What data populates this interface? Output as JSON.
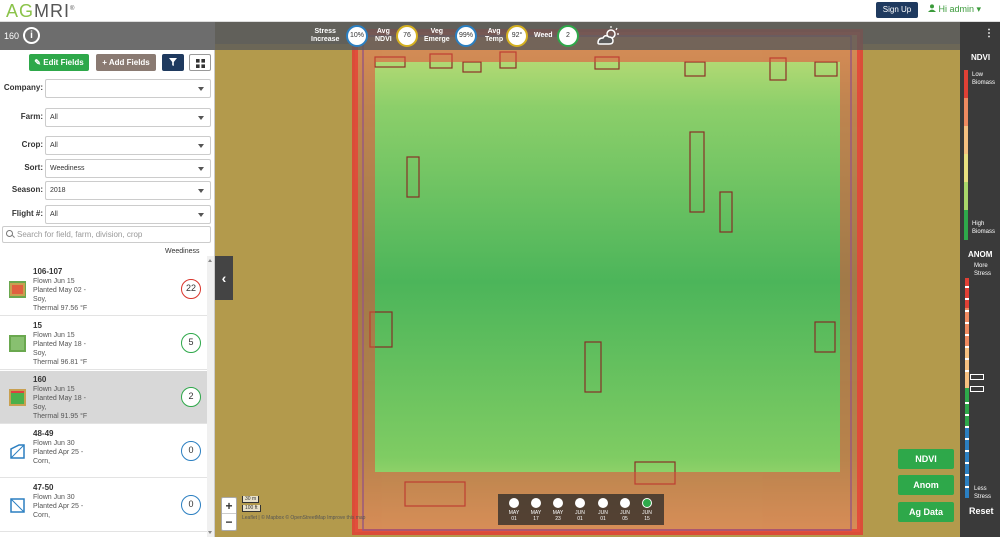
{
  "header": {
    "logo_ag": "AG",
    "logo_mri": "MRI",
    "logo_mark": "®",
    "signup": "Sign Up",
    "user": "Hi admin"
  },
  "fieldbar": {
    "field_number": "160",
    "info_icon": "info-icon"
  },
  "toolbar": {
    "edit_fields": "Edit Fields",
    "add_fields": "Add Fields",
    "filter_icon": "filter-icon",
    "grid_icon": "grid-icon"
  },
  "filters": [
    {
      "label": "Company:",
      "value": ""
    },
    {
      "label": "Farm:",
      "value": "All"
    },
    {
      "label": "Crop:",
      "value": "All"
    },
    {
      "label": "Sort:",
      "value": "Weediness"
    },
    {
      "label": "Season:",
      "value": "2018"
    },
    {
      "label": "Flight #:",
      "value": "All"
    }
  ],
  "search": {
    "placeholder": "Search for field, farm, division, crop"
  },
  "list_header": "Weediness",
  "fields": [
    {
      "name": "106-107",
      "flown": "Flown Jun 15",
      "planted": "Planted May 02 -",
      "crop": "Soy,",
      "thermal": "Thermal 97.56 °F",
      "weed": "22",
      "color": "#d9342b",
      "selected": false
    },
    {
      "name": "15",
      "flown": "Flown Jun 15",
      "planted": "Planted May 18 -",
      "crop": "Soy,",
      "thermal": "Thermal 96.81 °F",
      "weed": "5",
      "color": "#2ea84a",
      "selected": false
    },
    {
      "name": "160",
      "flown": "Flown Jun 15",
      "planted": "Planted May 18 -",
      "crop": "Soy,",
      "thermal": "Thermal 91.95 °F",
      "weed": "2",
      "color": "#2ea84a",
      "selected": true
    },
    {
      "name": "48-49",
      "flown": "Flown Jun 30",
      "planted": "Planted Apr 25 -",
      "crop": "Corn,",
      "thermal": "",
      "weed": "0",
      "color": "#2b7fc1",
      "selected": false
    },
    {
      "name": "47-50",
      "flown": "Flown Jun 30",
      "planted": "Planted Apr 25 -",
      "crop": "Corn,",
      "thermal": "",
      "weed": "0",
      "color": "#2b7fc1",
      "selected": false
    }
  ],
  "stats": {
    "stress_l1": "Stress",
    "stress_l2": "Increase",
    "stress_v": "10%",
    "ndvi_l1": "Avg",
    "ndvi_l2": "NDVI",
    "ndvi_v": "76",
    "emerge_l1": "Veg",
    "emerge_l2": "Emerge",
    "emerge_v": "99%",
    "temp_l1": "Avg",
    "temp_l2": "Temp",
    "temp_v": "92°",
    "weed_l1": "Weed",
    "weed_v": "2",
    "weather_icon": "partly-cloudy-icon"
  },
  "map": {
    "collapse_icon": "chevron-left-icon",
    "zoom_in": "+",
    "zoom_out": "−",
    "scale_m": "30 m",
    "scale_ft": "100 ft",
    "attribution": "Leaflet | © Mapbox © OpenStreetMap Improve this map"
  },
  "timeline": [
    {
      "m": "MAY",
      "d": "01",
      "active": false
    },
    {
      "m": "MAY",
      "d": "17",
      "active": false
    },
    {
      "m": "MAY",
      "d": "23",
      "active": false
    },
    {
      "m": "JUN",
      "d": "01",
      "active": false
    },
    {
      "m": "JUN",
      "d": "01",
      "active": false
    },
    {
      "m": "JUN",
      "d": "05",
      "active": false
    },
    {
      "m": "JUN",
      "d": "15",
      "active": true
    }
  ],
  "buttons": {
    "ndvi": "NDVI",
    "anom": "Anom",
    "agdata": "Ag Data"
  },
  "legend": {
    "menu": "⋮",
    "ndvi_title": "NDVI",
    "low_1": "Low",
    "low_2": "Biomass",
    "high_1": "High",
    "high_2": "Biomass",
    "anom_title": "ANOM",
    "more_1": "More",
    "more_2": "Stress",
    "less_1": "Less",
    "less_2": "Stress",
    "reset": "Reset"
  },
  "colors": {
    "brand_green": "#2ea84a",
    "navy": "#1f3a5f",
    "stress_red": "#d9342b",
    "calm_blue": "#2b7fc1"
  }
}
